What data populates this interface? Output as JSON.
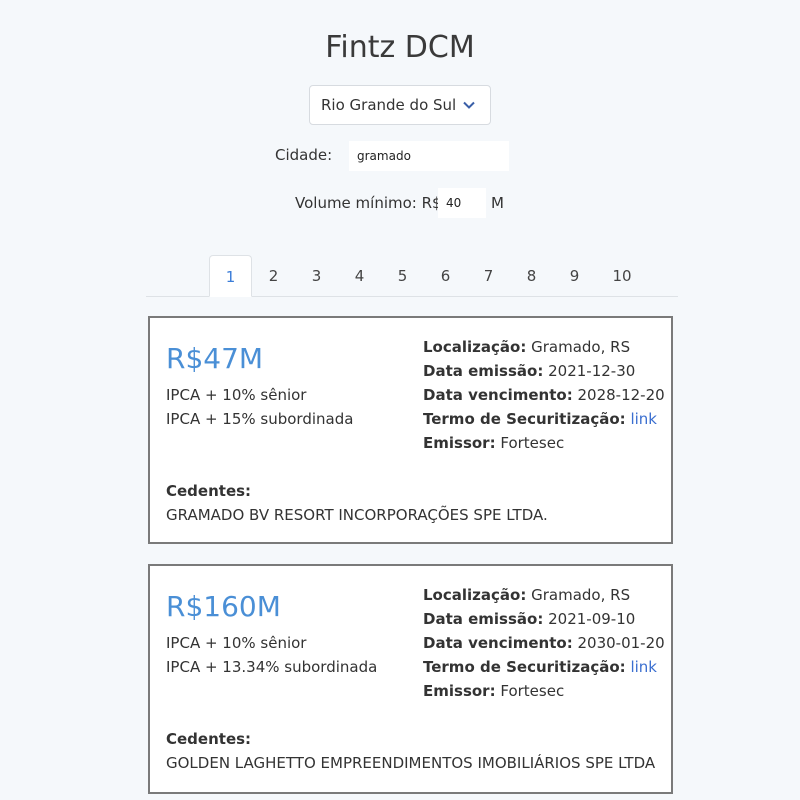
{
  "app": {
    "title": "Fintz DCM"
  },
  "filters": {
    "state_value": "Rio Grande do Sul",
    "city_label": "Cidade:",
    "city_value": "gramado",
    "volume_label": "Volume mínimo: R$",
    "volume_value": "40",
    "volume_unit": "M"
  },
  "pagination": {
    "pages": [
      "1",
      "2",
      "3",
      "4",
      "5",
      "6",
      "7",
      "8",
      "9",
      "10"
    ],
    "active": "1"
  },
  "labels": {
    "location": "Localização:",
    "issue_date": "Data emissão:",
    "maturity_date": "Data vencimento:",
    "securitization_term": "Termo de Securitização:",
    "issuer": "Emissor:",
    "assignors": "Cedentes:",
    "link_text": "link"
  },
  "cards": [
    {
      "amount": "R$47M",
      "senior": "IPCA + 10% sênior",
      "subordinate": "IPCA + 15% subordinada",
      "location": "Gramado, RS",
      "issue_date": "2021-12-30",
      "maturity_date": "2028-12-20",
      "issuer": "Fortesec",
      "assignor": "GRAMADO BV RESORT INCORPORAÇÕES SPE LTDA."
    },
    {
      "amount": "R$160M",
      "senior": "IPCA + 10% sênior",
      "subordinate": "IPCA + 13.34% subordinada",
      "location": "Gramado, RS",
      "issue_date": "2021-09-10",
      "maturity_date": "2030-01-20",
      "issuer": "Fortesec",
      "assignor": "GOLDEN LAGHETTO EMPREENDIMENTOS IMOBILIÁRIOS SPE LTDA"
    }
  ],
  "colors": {
    "amount": "#4a8fd6",
    "link": "#3b6fd0",
    "active_tab": "#3b7dd8",
    "card_border": "#7a7a7a",
    "background": "#f5f8fb"
  }
}
